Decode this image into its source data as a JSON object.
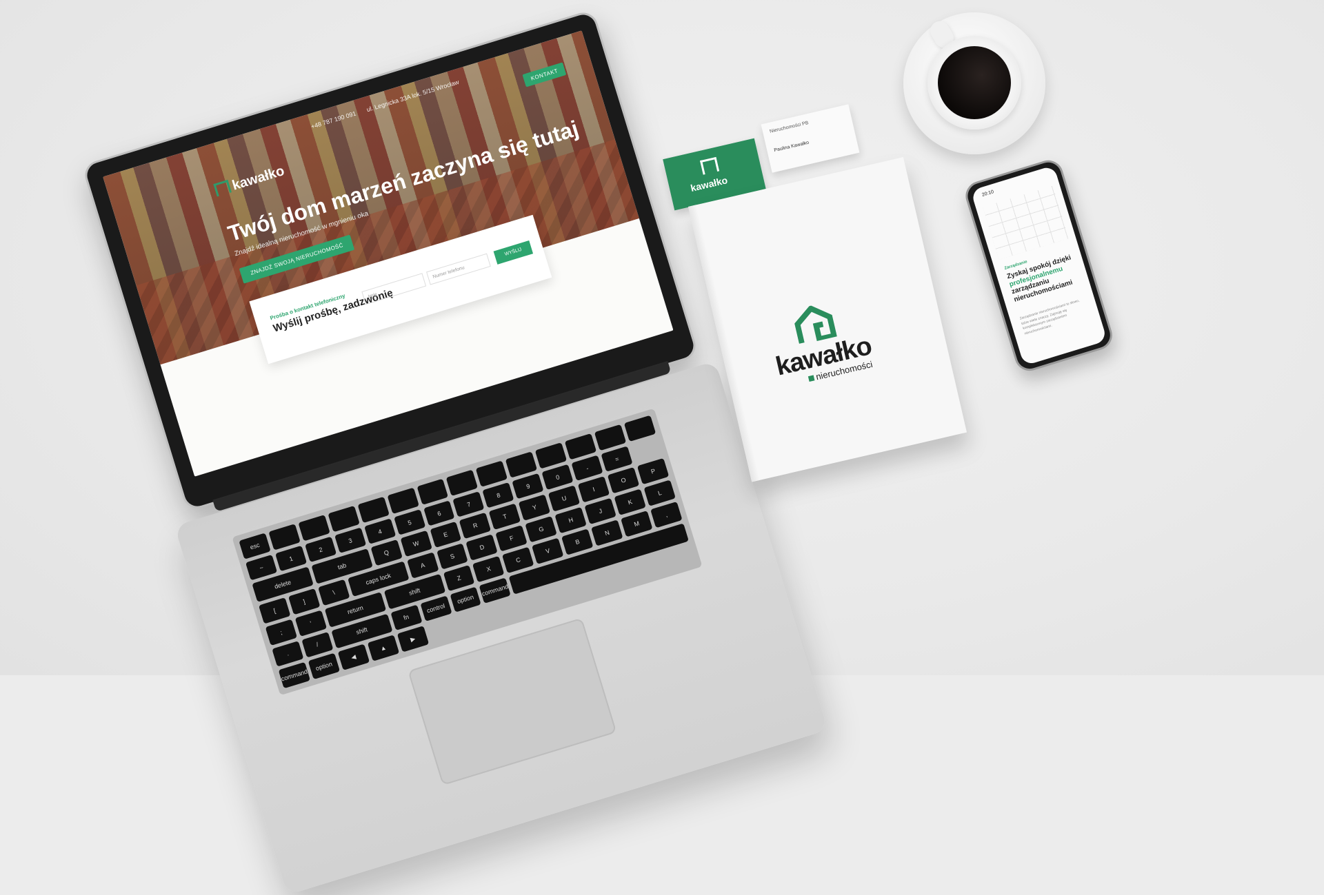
{
  "website": {
    "nav_phone": "+48 787 190 091",
    "nav_address": "ul. Legnicka 33A lok. 5/15 Wrocław",
    "nav_contact_button": "KONTAKT",
    "logo_text": "kawałko",
    "hero_title": "Twój dom marzeń zaczyna się tutaj",
    "hero_subtitle": "Znajdź idealną nieruchomość w mgnieniu oka",
    "hero_button": "ZNAJDŹ SWOJĄ NIERUCHOMOŚĆ",
    "form_eyebrow": "Prośba o kontakt telefoniczny",
    "form_title": "Wyślij prośbę, zadzwonię",
    "form_name_placeholder": "Imię",
    "form_phone_placeholder": "Numer telefonu",
    "form_send_button": "WYŚLIJ"
  },
  "keyboard": {
    "labels": [
      "esc",
      "",
      "",
      "",
      "",
      "",
      "",
      "",
      "",
      "",
      "",
      "",
      "",
      "",
      "~",
      "1",
      "2",
      "3",
      "4",
      "5",
      "6",
      "7",
      "8",
      "9",
      "0",
      "-",
      "=",
      "delete",
      "tab",
      "Q",
      "W",
      "E",
      "R",
      "T",
      "Y",
      "U",
      "I",
      "O",
      "P",
      "[",
      "]",
      "\\",
      "caps lock",
      "A",
      "S",
      "D",
      "F",
      "G",
      "H",
      "J",
      "K",
      "L",
      ";",
      "'",
      "return",
      "shift",
      "Z",
      "X",
      "C",
      "V",
      "B",
      "N",
      "M",
      ",",
      ".",
      "/",
      "shift",
      "fn",
      "control",
      "option",
      "command",
      "",
      "command",
      "option",
      "◀",
      "▲",
      "▶"
    ]
  },
  "business_card_green": {
    "logo_text": "kawałko"
  },
  "business_card_white": {
    "label": "Nieruchomości PB",
    "name": "Paulina Kawałko"
  },
  "brochure": {
    "logo_word": "kawałko",
    "logo_sub": "nieruchomości"
  },
  "phone": {
    "time": "20:10",
    "eyebrow": "Zarządzanie",
    "title_a": "Zyskaj spokój dzięki ",
    "title_green": "profesjonalnemu",
    "title_b": " zarządzaniu nieruchomościami",
    "body": "Zarządzanie nieruchomościami to słowo, które wiele znaczy. Zajmuję się kompleksowym zarządzaniem nieruchomościami."
  },
  "colors": {
    "brand_green": "#2a8d5c",
    "accent_green": "#2ea56f"
  }
}
